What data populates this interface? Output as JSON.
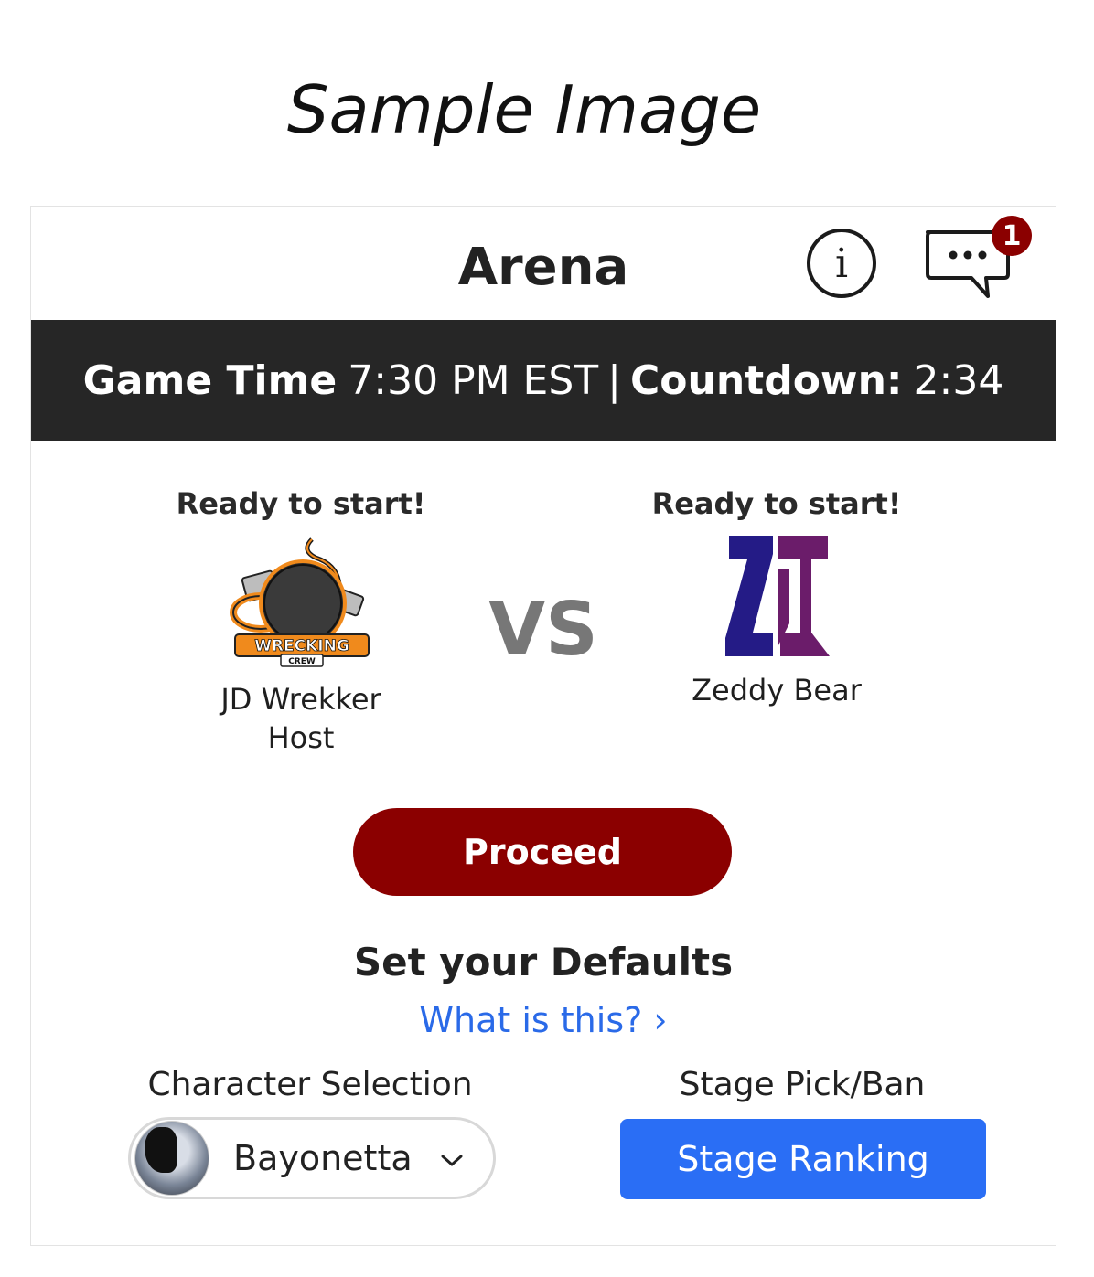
{
  "sample_title": "Sample Image",
  "header": {
    "title": "Arena",
    "info_icon": "i",
    "chat_badge_count": "1"
  },
  "timebar": {
    "game_time_label": "Game Time",
    "game_time_value": "7:30 PM EST",
    "separator": "|",
    "countdown_label": "Countdown:",
    "countdown_value": "2:34"
  },
  "match": {
    "left": {
      "status": "Ready to start!",
      "name": "JD Wrekker",
      "role": "Host",
      "logo_text": "WRECKING",
      "logo_subtext": "CREW",
      "logo_icon": "wrecking-ball-icon"
    },
    "vs_label": "VS",
    "right": {
      "status": "Ready to start!",
      "name": "Zeddy Bear",
      "logo_icon": "zs-logo"
    }
  },
  "proceed_label": "Proceed",
  "defaults": {
    "title": "Set your Defaults",
    "help_link": "What is this? ›",
    "character_label": "Character Selection",
    "character_value": "Bayonetta",
    "stage_label": "Stage Pick/Ban",
    "stage_button": "Stage Ranking"
  },
  "colors": {
    "accent_red": "#8b0000",
    "link_blue": "#2a6ae8",
    "button_blue": "#2a6ef5",
    "bar_dark": "#262626"
  }
}
